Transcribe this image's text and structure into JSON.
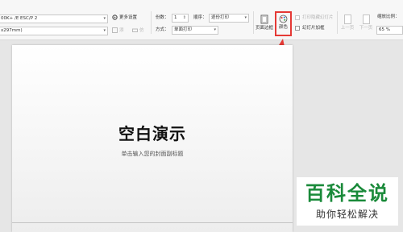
{
  "ribbon": {
    "left": {
      "printer_value": "00K+ /E ESC/P 2",
      "paper_value": "x297mm)"
    },
    "more_settings_label": "更多设置",
    "watermark_label": "添",
    "print_label": "仿",
    "copies_label": "份数：",
    "copies_value": "1",
    "order_label": "顺序：",
    "order_value": "逐份打印",
    "method_label": "方式：",
    "method_value": "单面打印",
    "page_border_label": "页面边框",
    "color_label": "颜色",
    "print_hidden_label": "打印隐藏幻灯片",
    "slide_frame_label": "幻灯片加框",
    "prev_label": "上一页",
    "next_label": "下一页",
    "zoom_label": "缩放比例：",
    "zoom_value": "65 %"
  },
  "slide": {
    "title": "空白演示",
    "subtitle": "单击输入您的封面副标题"
  },
  "watermark": {
    "title": "百科全说",
    "subtitle": "助你轻松解决"
  },
  "colors": {
    "highlight": "#e53935",
    "watermark_green": "#1a8a3a"
  }
}
